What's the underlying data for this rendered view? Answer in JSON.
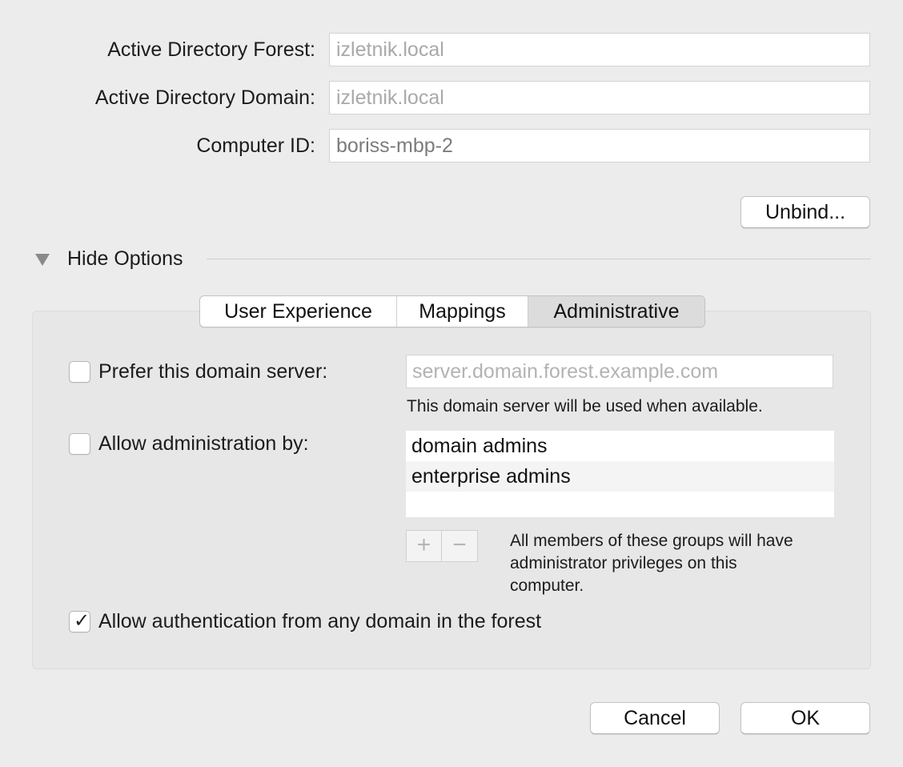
{
  "form": {
    "forest_label": "Active Directory Forest:",
    "forest_value": "izletnik.local",
    "domain_label": "Active Directory Domain:",
    "domain_value": "izletnik.local",
    "computer_id_label": "Computer ID:",
    "computer_id_value": "boriss-mbp-2"
  },
  "unbind_button": "Unbind...",
  "options_toggle": {
    "label": "Hide Options",
    "icon": "disclosure-triangle-down-icon"
  },
  "tabs": [
    {
      "label": "User Experience",
      "selected": false
    },
    {
      "label": "Mappings",
      "selected": false
    },
    {
      "label": "Administrative",
      "selected": true
    }
  ],
  "administrative": {
    "prefer_server": {
      "label": "Prefer this domain server:",
      "checked": false,
      "placeholder": "server.domain.forest.example.com",
      "hint": "This domain server will be used when available."
    },
    "allow_admin": {
      "label": "Allow administration by:",
      "checked": false,
      "groups": [
        "domain admins",
        "enterprise admins"
      ],
      "add_symbol": "+",
      "remove_symbol": "−",
      "hint_lines": [
        "All members of these groups will have",
        "administrator privileges on this",
        "computer."
      ]
    },
    "allow_auth": {
      "label": "Allow authentication from any domain in the forest",
      "checked": true,
      "check_symbol": "✓"
    }
  },
  "footer": {
    "cancel_label": "Cancel",
    "ok_label": "OK"
  },
  "colors": {
    "window_background": "#ececec",
    "panel_background": "#e7e7e7",
    "selected_tab": "#dcdcdc"
  }
}
